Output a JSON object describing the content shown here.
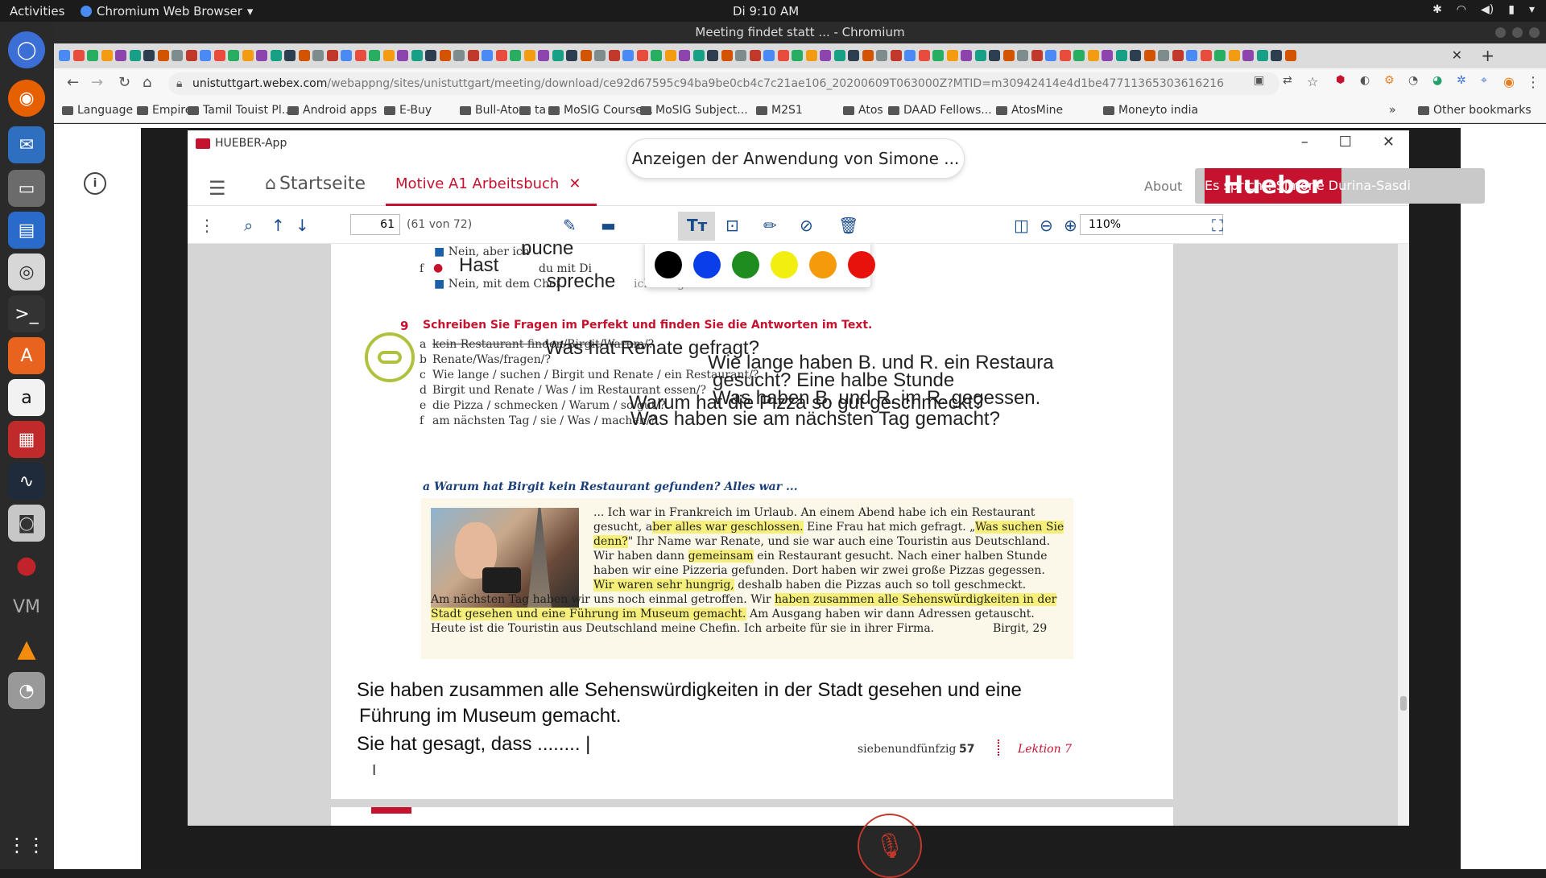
{
  "system_bar": {
    "activities": "Activities",
    "app_name": "Chromium Web Browser",
    "clock": "Di  9:10 AM"
  },
  "window": {
    "title": "Meeting findet statt ... - Chromium"
  },
  "browser": {
    "url_main": "unistuttgart.webex.com",
    "url_tail": "/webappng/sites/unistuttgart/meeting/download/ce92d67595c94ba9be0cb4c7c21ae106_20200609T063000Z?MTID=m30942414e4d1be47711365303616216​5&launchApp...",
    "bookmarks": [
      "Language",
      "Empire",
      "Tamil Touist Pl...",
      "Android apps",
      "E-Buy",
      "Bull-Atos",
      "ta",
      "MoSIG Course...",
      "MoSIG Subject...",
      "M2S1",
      "Atos",
      "DAAD Fellows...",
      "AtosMine",
      "Moneyto india"
    ],
    "other_bookmarks": "Other bookmarks"
  },
  "webex": {
    "share_tooltip": "Anzeigen der Anwendung von Simone ...",
    "speaker_label": "Es spricht: Simone Durina-Sasdi"
  },
  "hueber": {
    "app_title": "HUEBER-App",
    "home": "Startseite",
    "book_tab": "Motive A1 Arbeitsbuch",
    "about": "About",
    "logo_text": "Hueber",
    "page_current": "61",
    "page_count": "(61 von 72)",
    "zoom": "110%",
    "colors": [
      "#000000",
      "#0a3ee8",
      "#1e8c1e",
      "#f2ee10",
      "#f59b0b",
      "#e8120c"
    ]
  },
  "page": {
    "top_lines": {
      "line1_prefix": "Nein, aber ich",
      "line1_hand": "buche",
      "line2_letter": "f",
      "line2_hand": "Hast",
      "line2_rest": "du mit Di",
      "line3_prefix": "Nein, mit dem Chef",
      "line3_hand": "spreche",
      "line3_rest": "ich morgen"
    },
    "exercise": {
      "number": "9",
      "title": "Schreiben Sie Fragen im Perfekt und finden Sie die Antworten im Text.",
      "items": [
        {
          "letter": "a",
          "prompt": "kein Restaurant finden/Birgit/Warum/?",
          "answer": ""
        },
        {
          "letter": "b",
          "prompt": "Renate/Was/fragen/?",
          "answer": "Was hat Renate gefragt?"
        },
        {
          "letter": "c",
          "prompt": "Wie lange / suchen / Birgit und Renate / ein Restaurant/?",
          "answer": "Wie lange haben B. und R. ein Restaura"
        },
        {
          "letter": "d",
          "prompt": "Birgit und Renate / Was / im Restaurant essen/?",
          "answer": "gesucht? Eine halbe Stunde"
        },
        {
          "letter": "e",
          "prompt": "die Pizza / schmecken / Warum / so gut/?",
          "answer": "Warum hat die Pizza so gut geschmeckt?"
        },
        {
          "letter": "f",
          "prompt": "am nächsten Tag / sie / Was / machen/?",
          "answer": "Was haben sie am nächsten Tag gemacht?"
        }
      ],
      "extra_answer": "Was haben B. und R. im R. gegessen.",
      "sample": "a  Warum hat Birgit kein Restaurant gefunden? Alles war ..."
    },
    "reading": {
      "l1": "... Ich war in Frankreich im Urlaub. An einem Abend habe ich ein Restaurant",
      "l2a": "gesucht, a",
      "l2b": "ber alles war geschlossen.",
      "l2c": " Eine Frau hat mich gefragt. „",
      "l2d": "Was suchen Sie",
      "l3a": "denn?",
      "l3b": "\" Ihr Name war Renate, und sie war auch eine Touristin aus Deutschland.",
      "l4a": "Wir haben dann ",
      "l4b": "gemeinsam",
      "l4c": " ein Restaurant gesucht. Nach einer halben Stunde",
      "l5": "haben wir eine Pizzeria gefunden. Dort haben wir zwei große Pizzas gegessen.",
      "l6a": "Wir waren sehr hungrig,",
      "l6b": " deshalb haben die Pizzas auch so toll geschmeckt.",
      "l7a": "Am nächsten Tag haben wir uns noch einmal getroffen. Wir ",
      "l7b": "haben zusammen alle Sehenswürdigkeiten in der",
      "l8a": "Stadt gesehen und eine Führung im Museum gemacht.",
      "l8b": " Am Ausgang haben wir dann Adressen getauscht.",
      "l9": "Heute ist die Touristin aus Deutschland meine Chefin. Ich arbeite für sie in ihrer Firma.",
      "signature": "Birgit, 29"
    },
    "typed_answer_1": "Sie haben zusammen alle Sehenswürdigkeiten in der Stadt gesehen und eine",
    "typed_answer_2": "Führung im Museum gemacht.",
    "typed_answer_3": "Sie hat gesagt, dass ........",
    "footer_words": "siebenundfünfzig",
    "footer_num": "57",
    "footer_lesson": "Lektion 7"
  }
}
